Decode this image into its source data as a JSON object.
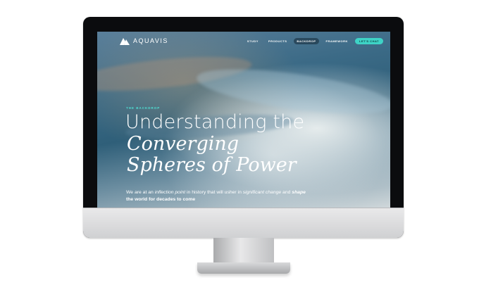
{
  "brand": {
    "name": "AQUAVIS",
    "logo_icon": "triangle-mountain-icon"
  },
  "nav": {
    "items": [
      {
        "label": "STUDY",
        "active": false
      },
      {
        "label": "PRODUCTS",
        "active": false
      },
      {
        "label": "BACKDROP",
        "active": true
      },
      {
        "label": "FRAMEWORK",
        "active": false
      }
    ],
    "cta_label": "LET'S CHAT"
  },
  "hero": {
    "eyebrow": "THE BACKDROP",
    "headline_line1": "Understanding the",
    "headline_line2": "Converging",
    "headline_line3": "Spheres of Power",
    "intro": {
      "t1": "We are at an ",
      "t2": "inflection point",
      "t3": " in history that will usher in ",
      "t4": "significant change",
      "t5": " and ",
      "t6": "shape",
      "t7": " the world for decades to come"
    }
  },
  "colors": {
    "accent": "#3ed3c6",
    "eyebrow": "#4fe0d3",
    "bezel": "#0b0c0e"
  }
}
